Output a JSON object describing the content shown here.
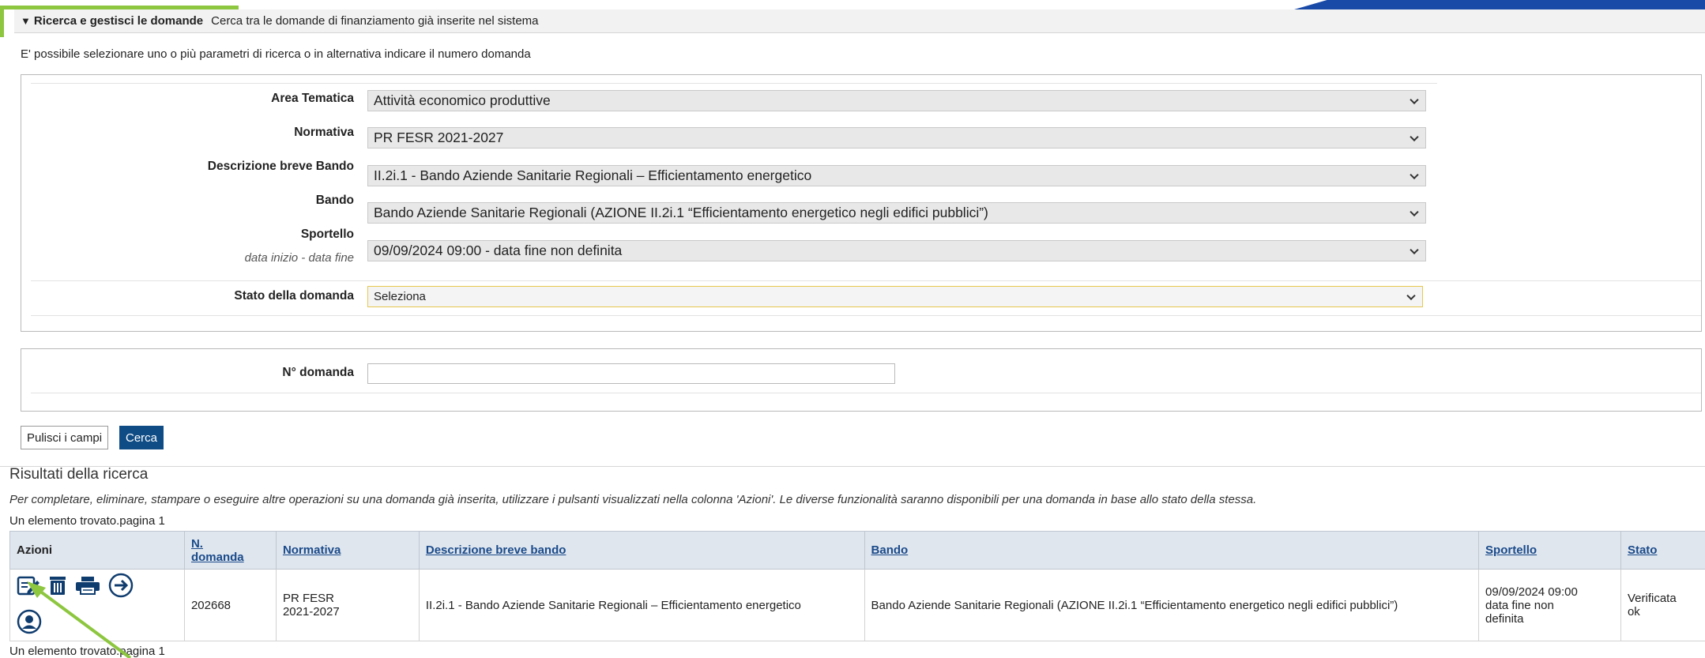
{
  "section": {
    "title": "Ricerca e gestisci le domande",
    "subtitle": "Cerca tra le domande di finanziamento già inserite nel sistema"
  },
  "intro_text": "E' possibile selezionare uno o più parametri di ricerca o in alternativa indicare il numero domanda",
  "filters": {
    "area_tematica": {
      "label": "Area Tematica",
      "value": "Attività economico produttive"
    },
    "normativa": {
      "label": "Normativa",
      "value": "PR FESR 2021-2027"
    },
    "descrizione_bando": {
      "label": "Descrizione breve Bando",
      "value": "II.2i.1 - Bando Aziende Sanitarie Regionali – Efficientamento energetico"
    },
    "bando": {
      "label": "Bando",
      "value": "Bando Aziende Sanitarie Regionali (AZIONE II.2i.1 “Efficientamento energetico negli edifici pubblici”)"
    },
    "sportello": {
      "label": "Sportello",
      "sublabel": "data inizio - data fine",
      "value": "09/09/2024 09:00 - data fine non definita"
    },
    "stato": {
      "label": "Stato della domanda",
      "value": "Seleziona"
    }
  },
  "numero_domanda": {
    "label": "N° domanda",
    "value": ""
  },
  "buttons": {
    "clear": "Pulisci i campi",
    "search": "Cerca"
  },
  "results": {
    "title": "Risultati della ricerca",
    "note": "Per completare, eliminare, stampare o eseguire altre operazioni su una domanda già inserita, utilizzare i pulsanti visualizzati nella colonna 'Azioni'. Le diverse funzionalità saranno disponibili per una domanda in base allo stato della stessa.",
    "found_top": "Un elemento trovato.pagina 1",
    "found_bottom": "Un elemento trovato.pagina 1",
    "columns": {
      "azioni": "Azioni",
      "n_domanda_1": "N.",
      "n_domanda_2": "domanda",
      "normativa": "Normativa",
      "descrizione": "Descrizione breve bando",
      "bando": "Bando",
      "sportello": "Sportello",
      "stato": "Stato"
    },
    "rows": [
      {
        "n_domanda": "202668",
        "normativa_1": "PR FESR",
        "normativa_2": "2021-2027",
        "descrizione": "II.2i.1 - Bando Aziende Sanitarie Regionali – Efficientamento energetico",
        "bando": "Bando Aziende Sanitarie Regionali (AZIONE II.2i.1 “Efficientamento energetico negli edifici pubblici”)",
        "sportello_1": "09/09/2024 09:00",
        "sportello_2": "data fine non",
        "sportello_3": "definita",
        "stato_1": "Verificata",
        "stato_2": "ok"
      }
    ]
  },
  "icons": [
    "edit-icon",
    "trash-icon",
    "print-icon",
    "arrow-right-circle-icon",
    "user-icon"
  ],
  "colors": {
    "header_blue": "#0f4c86",
    "accent_green": "#8dc63f",
    "banner_blue": "#1a4aa8"
  }
}
